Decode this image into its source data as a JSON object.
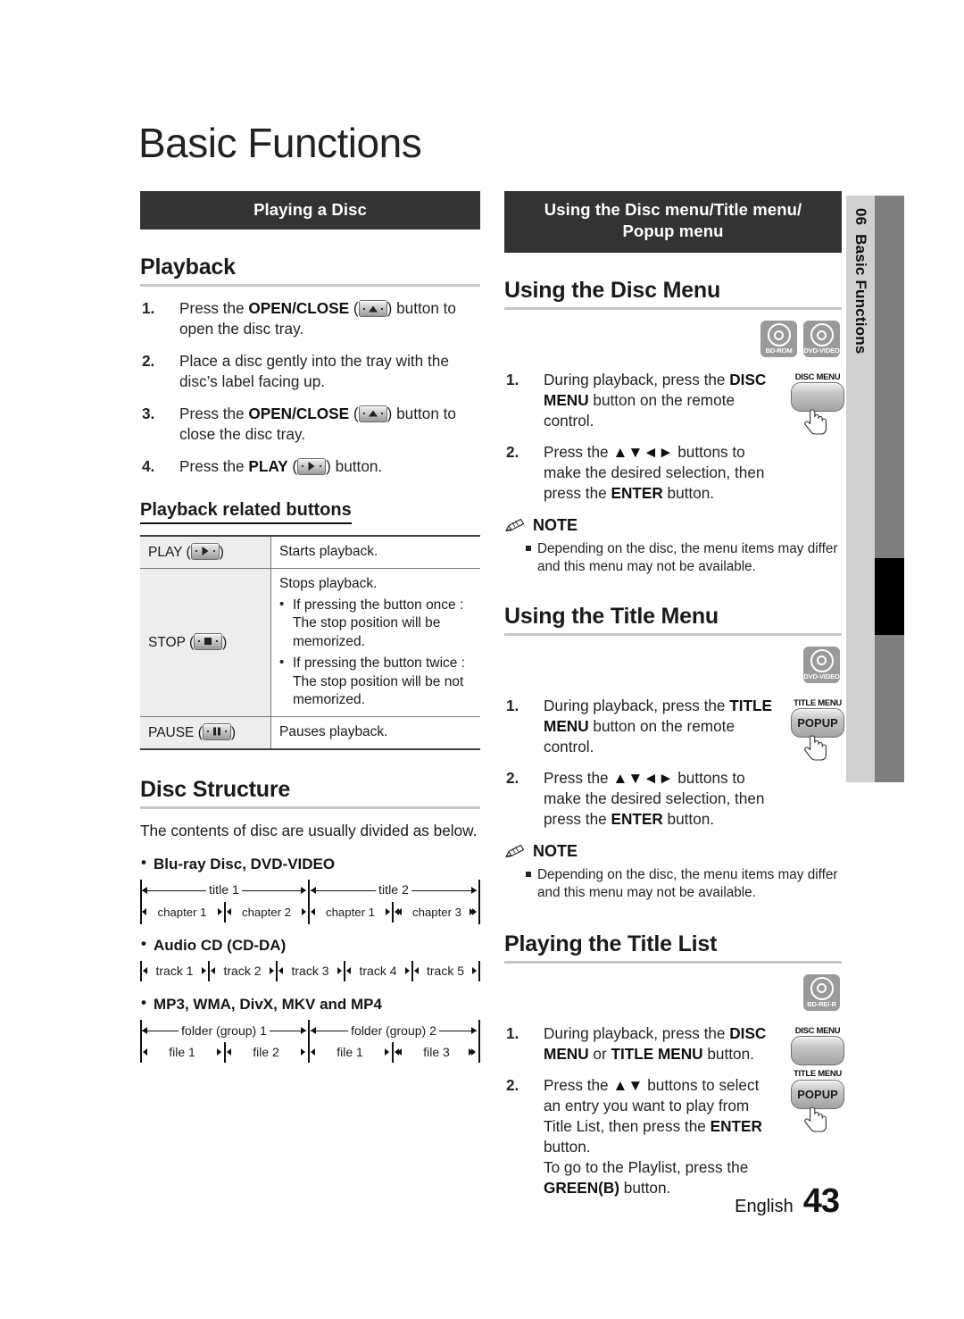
{
  "page": {
    "title": "Basic Functions",
    "footer_language": "English",
    "footer_page_number": "43",
    "side_tab_number": "06",
    "side_tab_label": "Basic Functions"
  },
  "left_column": {
    "banner": "Playing a Disc",
    "playback": {
      "heading": "Playback",
      "steps": [
        {
          "num": "1.",
          "before": "Press the ",
          "bold": "OPEN/CLOSE",
          "paren_open": " (",
          "icon": "eject-key",
          "paren_close": ") button to open the disc tray."
        },
        {
          "num": "2.",
          "text": "Place a disc gently into the tray with the disc’s label facing up."
        },
        {
          "num": "3.",
          "before": "Press the ",
          "bold": "OPEN/CLOSE",
          "paren_open": " (",
          "icon": "eject-key",
          "paren_close": ") button to close the disc tray."
        },
        {
          "num": "4.",
          "before": "Press the ",
          "bold": "PLAY",
          "paren_open": " (",
          "icon": "play-key",
          "paren_close": ") button."
        }
      ]
    },
    "related_buttons": {
      "heading": "Playback related buttons",
      "rows": [
        {
          "key_label": "PLAY (",
          "key_icon": "play-key",
          "key_close": ")",
          "value_main": "Starts playback.",
          "value_bullets": []
        },
        {
          "key_label": "STOP (",
          "key_icon": "stop-key",
          "key_close": ")",
          "value_main": "Stops playback.",
          "value_bullets": [
            "If pressing the button once : The stop position will be memorized.",
            "If pressing the button twice : The stop position will be not memorized."
          ]
        },
        {
          "key_label": "PAUSE (",
          "key_icon": "pause-key",
          "key_close": ")",
          "value_main": "Pauses playback.",
          "value_bullets": []
        }
      ]
    },
    "disc_structure": {
      "heading": "Disc Structure",
      "intro": "The contents of disc are usually divided as below.",
      "groups": [
        {
          "label": "Blu-ray Disc, DVD-VIDEO",
          "titles": [
            "title 1",
            "title 2"
          ],
          "chapters": [
            "chapter 1",
            "chapter 2",
            "chapter 1",
            "chapter 2",
            "chapter 3"
          ]
        },
        {
          "label": "Audio CD (CD-DA)",
          "tracks": [
            "track 1",
            "track 2",
            "track 3",
            "track 4",
            "track 5"
          ]
        },
        {
          "label": "MP3, WMA, DivX, MKV and MP4",
          "folders": [
            "folder (group) 1",
            "folder (group) 2"
          ],
          "files": [
            "file 1",
            "file 2",
            "file 1",
            "file 2",
            "file 3"
          ]
        }
      ]
    }
  },
  "right_column": {
    "banner_line1": "Using the Disc menu/Title menu/",
    "banner_line2": "Popup menu",
    "disc_menu": {
      "heading": "Using the Disc Menu",
      "badges": [
        "BD-ROM",
        "DVD-VIDEO"
      ],
      "remote_keys": [
        {
          "caption": "DISC MENU",
          "label": ""
        }
      ],
      "steps": [
        {
          "num": "1.",
          "before": "During playback, press the ",
          "bold": "DISC MENU",
          "after": " button on the remote control."
        },
        {
          "num": "2.",
          "before": "Press the ",
          "arrows": "▲▼◄►",
          "middle": " buttons to make the desired selection, then press the ",
          "bold": "ENTER",
          "after": " button."
        }
      ],
      "note_heading": "NOTE",
      "note_items": [
        "Depending on the disc, the menu items may differ and this menu may not be available."
      ]
    },
    "title_menu": {
      "heading": "Using the Title Menu",
      "badges": [
        "DVD-VIDEO"
      ],
      "remote_keys": [
        {
          "caption": "TITLE MENU",
          "label": "POPUP"
        }
      ],
      "steps": [
        {
          "num": "1.",
          "before": "During playback, press the ",
          "bold": "TITLE MENU",
          "after": " button on the remote control."
        },
        {
          "num": "2.",
          "before": "Press the ",
          "arrows": "▲▼◄►",
          "middle": " buttons to make the desired selection, then press the ",
          "bold": "ENTER",
          "after": " button."
        }
      ],
      "note_heading": "NOTE",
      "note_items": [
        "Depending on the disc, the menu items may differ and this menu may not be available."
      ]
    },
    "title_list": {
      "heading": "Playing the Title List",
      "badges": [
        "BD-RE/-R"
      ],
      "remote_keys": [
        {
          "caption": "DISC MENU",
          "label": ""
        },
        {
          "caption": "TITLE MENU",
          "label": "POPUP"
        }
      ],
      "steps": [
        {
          "num": "1.",
          "before": "During playback, press the ",
          "bold1": "DISC MENU",
          "mid": " or ",
          "bold2": "TITLE MENU",
          "after": " button."
        },
        {
          "num": "2.",
          "before": "Press the ",
          "arrows": "▲▼",
          "middle": " buttons to select an entry you want to play from Title List, then press the ",
          "bold": "ENTER",
          "after": " button.",
          "line2_before": "To go to the Playlist, press the ",
          "line2_bold": "GREEN(B)",
          "line2_after": " button."
        }
      ]
    }
  },
  "colors": {
    "banner_bg": "#333333",
    "rule": "#c6c6c6",
    "side_tab": "#d0d0d0",
    "side_bar": "#7e7e7e",
    "table_key_bg": "#ededed"
  }
}
